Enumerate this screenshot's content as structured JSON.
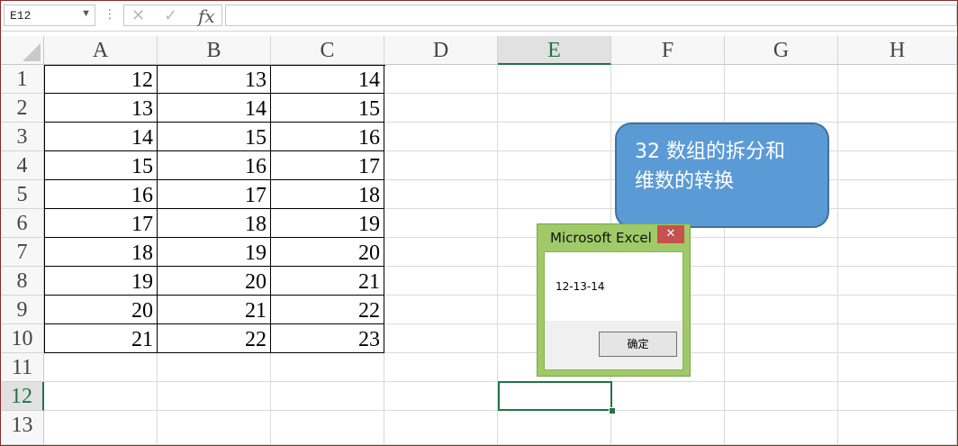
{
  "formula_bar": {
    "name_box": "E12",
    "cancel_icon": "✕",
    "enter_icon": "✓",
    "fx_label": "fx",
    "formula_value": ""
  },
  "columns": [
    "A",
    "B",
    "C",
    "D",
    "E",
    "F",
    "G",
    "H"
  ],
  "rows": [
    "1",
    "2",
    "3",
    "4",
    "5",
    "6",
    "7",
    "8",
    "9",
    "10",
    "11",
    "12",
    "13"
  ],
  "active_cell": {
    "column": "E",
    "row": "12"
  },
  "cells": [
    [
      "12",
      "13",
      "14"
    ],
    [
      "13",
      "14",
      "15"
    ],
    [
      "14",
      "15",
      "16"
    ],
    [
      "15",
      "16",
      "17"
    ],
    [
      "16",
      "17",
      "18"
    ],
    [
      "17",
      "18",
      "19"
    ],
    [
      "18",
      "19",
      "20"
    ],
    [
      "19",
      "20",
      "21"
    ],
    [
      "20",
      "21",
      "22"
    ],
    [
      "21",
      "22",
      "23"
    ]
  ],
  "callout": {
    "line1": "32 数组的拆分和",
    "line2": "维数的转换"
  },
  "msgbox": {
    "title": "Microsoft Excel",
    "close_icon": "✕",
    "message": "12-13-14",
    "ok_label": "确定"
  },
  "colors": {
    "accent_green": "#217346",
    "callout_fill": "#5b9bd5",
    "dialog_frame": "#9fca67",
    "close_red": "#c75050"
  }
}
